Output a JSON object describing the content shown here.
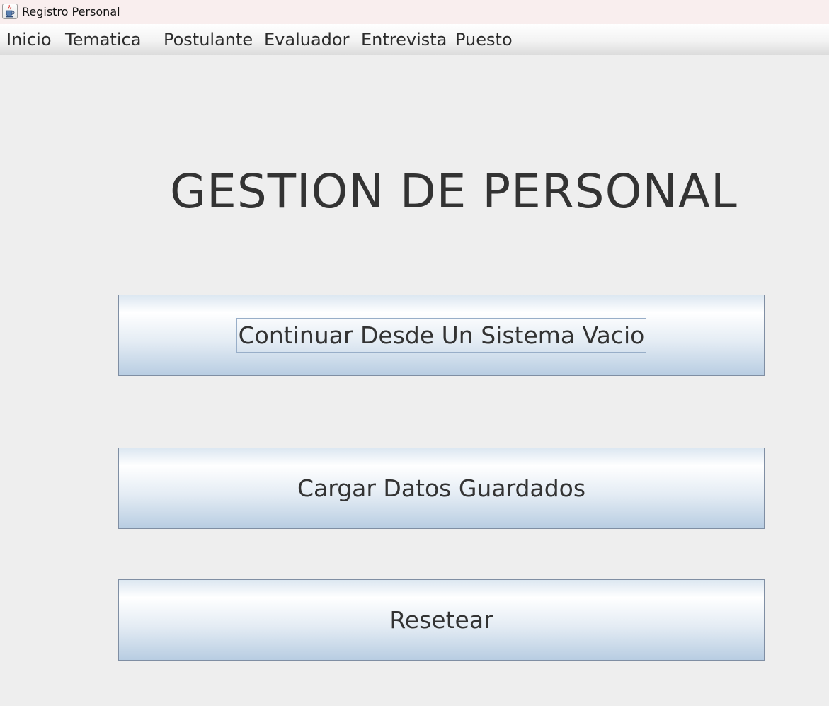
{
  "window": {
    "title": "Registro Personal",
    "icon": "java-cup-icon"
  },
  "menubar": {
    "items": [
      {
        "label": "Inicio"
      },
      {
        "label": "Tematica"
      },
      {
        "label": "Postulante"
      },
      {
        "label": "Evaluador"
      },
      {
        "label": "Entrevista"
      },
      {
        "label": "Puesto"
      }
    ]
  },
  "main": {
    "title": "GESTION DE PERSONAL",
    "buttons": [
      {
        "label": "Continuar Desde Un Sistema Vacio",
        "focused": true
      },
      {
        "label": "Cargar Datos Guardados",
        "focused": false
      },
      {
        "label": "Resetear",
        "focused": false
      }
    ]
  },
  "colors": {
    "background": "#eeeeee",
    "button_border": "#7f8ea3",
    "button_gradient_bottom": "#b8cde2",
    "text": "#333333"
  }
}
